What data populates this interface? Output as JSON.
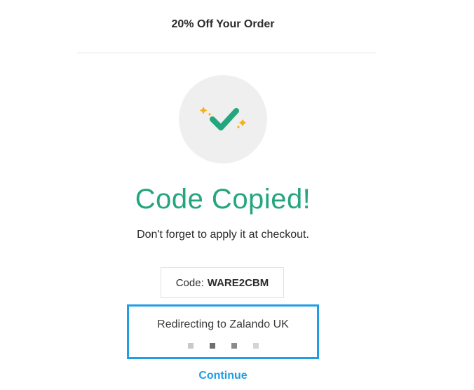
{
  "header": {
    "offer_title": "20% Off Your Order"
  },
  "success": {
    "icon": "checkmark-sparkle-icon",
    "headline": "Code Copied!",
    "subtext": "Don't forget to apply it at checkout."
  },
  "code": {
    "label": "Code:",
    "value": "WARE2CBM"
  },
  "redirect": {
    "text": "Redirecting to Zalando UK",
    "dots": [
      "#c9c9c9",
      "#6f6f6f",
      "#8a8a8a",
      "#d4d4d4"
    ]
  },
  "continue_label": "Continue",
  "colors": {
    "accent_green": "#23a67e",
    "sparkle": "#f2b21c",
    "link_blue": "#1f9ee6"
  }
}
